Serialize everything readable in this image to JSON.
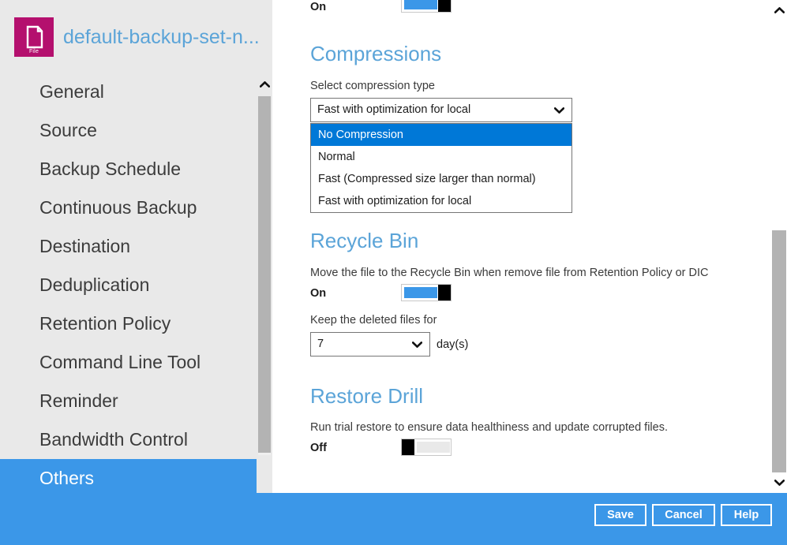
{
  "profile": {
    "icon_name": "file-document-icon",
    "icon_caption": "File",
    "title": "default-backup-set-n..."
  },
  "sidebar": {
    "items": [
      {
        "label": "General",
        "selected": false
      },
      {
        "label": "Source",
        "selected": false
      },
      {
        "label": "Backup Schedule",
        "selected": false
      },
      {
        "label": "Continuous Backup",
        "selected": false
      },
      {
        "label": "Destination",
        "selected": false
      },
      {
        "label": "Deduplication",
        "selected": false
      },
      {
        "label": "Retention Policy",
        "selected": false
      },
      {
        "label": "Command Line Tool",
        "selected": false
      },
      {
        "label": "Reminder",
        "selected": false
      },
      {
        "label": "Bandwidth Control",
        "selected": false
      },
      {
        "label": "Others",
        "selected": true
      }
    ],
    "scroll_up_icon": "chevron-up-icon",
    "scroll_down_icon": "chevron-down-icon"
  },
  "content": {
    "top_partial_toggle": {
      "state_label": "On",
      "state": "on"
    },
    "compressions": {
      "title": "Compressions",
      "field_label": "Select compression type",
      "selected_value": "Fast with optimization for local",
      "dropdown_open": true,
      "options": [
        {
          "label": "No Compression",
          "highlighted": true
        },
        {
          "label": "Normal",
          "highlighted": false
        },
        {
          "label": "Fast (Compressed size larger than normal)",
          "highlighted": false
        },
        {
          "label": "Fast with optimization for local",
          "highlighted": false
        }
      ]
    },
    "recycle_bin": {
      "title": "Recycle Bin",
      "description": "Move the file to the Recycle Bin when remove file from Retention Policy or DIC",
      "state_label": "On",
      "state": "on",
      "keep_label": "Keep the deleted files for",
      "keep_value": "7",
      "keep_unit": "day(s)"
    },
    "restore_drill": {
      "title": "Restore Drill",
      "description": "Run trial restore to ensure data healthiness and update corrupted files.",
      "state_label": "Off",
      "state": "off"
    },
    "scroll_up_icon": "chevron-up-icon",
    "scroll_down_icon": "chevron-down-icon"
  },
  "footer": {
    "save_label": "Save",
    "cancel_label": "Cancel",
    "help_label": "Help"
  },
  "colors": {
    "accent_blue": "#3b97e8",
    "heading_blue": "#5ba4d8",
    "highlight_blue": "#0078d7",
    "icon_magenta": "#b4106e",
    "sidebar_bg": "#e9e9e9",
    "scroll_thumb": "#b3b3b3"
  }
}
